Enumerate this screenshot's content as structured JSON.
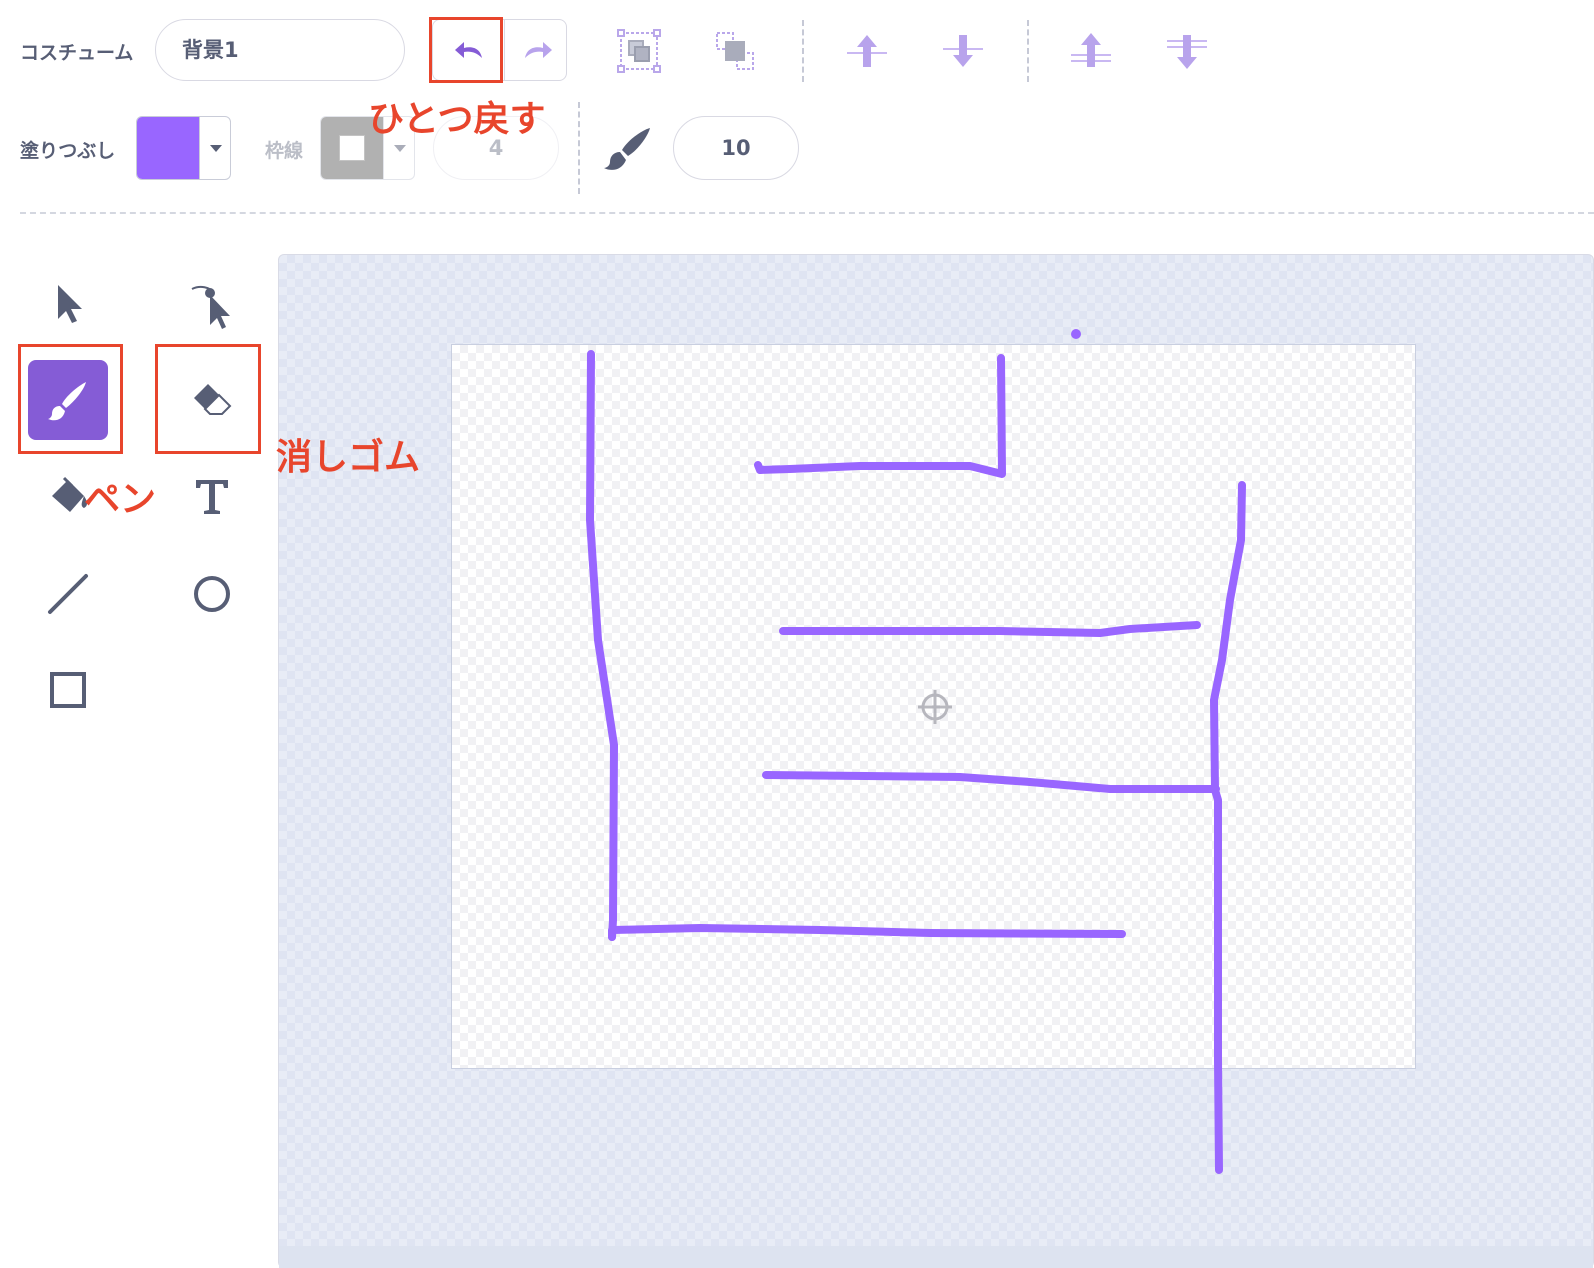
{
  "toolbar": {
    "costume_label": "コスチューム",
    "costume_name": "背景1",
    "fill_label": "塗りつぶし",
    "outline_label": "枠線",
    "outline_width": "4",
    "brush_size": "10"
  },
  "colors": {
    "accent": "#855cd6",
    "fill": "#9966ff",
    "annotation": "#e8452c",
    "icon": "#575e75"
  },
  "tools": [
    {
      "name": "select",
      "icon": "arrow-icon"
    },
    {
      "name": "reshape",
      "icon": "reshape-icon"
    },
    {
      "name": "brush",
      "icon": "brush-icon",
      "selected": true
    },
    {
      "name": "eraser",
      "icon": "eraser-icon"
    },
    {
      "name": "fill",
      "icon": "fill-bucket-icon"
    },
    {
      "name": "text",
      "icon": "text-icon"
    },
    {
      "name": "line",
      "icon": "line-icon"
    },
    {
      "name": "circle",
      "icon": "circle-icon"
    },
    {
      "name": "rectangle",
      "icon": "rectangle-icon"
    }
  ],
  "annotations": {
    "undo": "ひとつ戻す",
    "eraser": "消しゴム",
    "pen": "ペン"
  }
}
